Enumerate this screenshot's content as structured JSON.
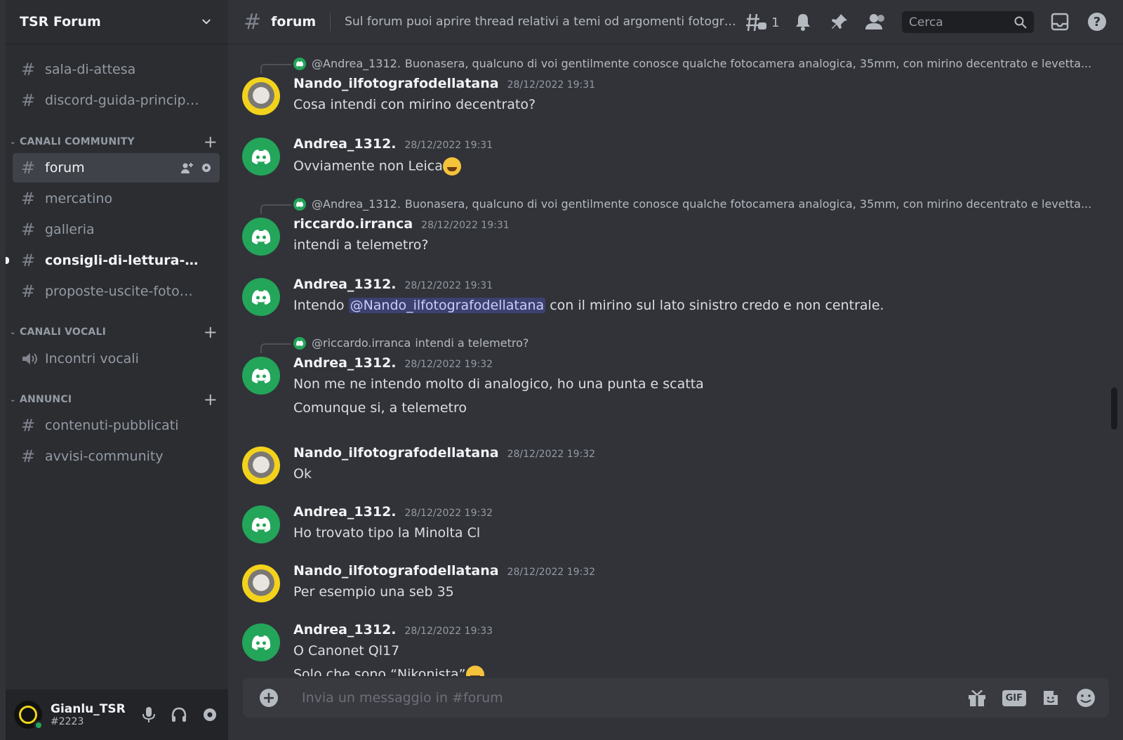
{
  "server": {
    "name": "TSR Forum"
  },
  "channels": {
    "top": [
      {
        "label": "sala-di-attesa"
      },
      {
        "label": "discord-guida-principi..."
      }
    ],
    "categories": [
      {
        "label": "CANALI COMMUNITY",
        "items": [
          {
            "label": "forum",
            "active": true
          },
          {
            "label": "mercatino"
          },
          {
            "label": "galleria"
          },
          {
            "label": "consigli-di-lettura-mo...",
            "unread": true
          },
          {
            "label": "proposte-uscite-fotog..."
          }
        ]
      },
      {
        "label": "CANALI VOCALI",
        "items": [
          {
            "label": "Incontri vocali"
          }
        ]
      },
      {
        "label": "ANNUNCI",
        "items": [
          {
            "label": "contenuti-pubblicati"
          },
          {
            "label": "avvisi-community"
          }
        ]
      }
    ]
  },
  "user": {
    "name": "Gianlu_TSR",
    "tag": "#2223"
  },
  "topbar": {
    "channel": "forum",
    "topic": "Sul forum puoi aprire thread relativi a temi od argomenti fotografici c...",
    "threads_count": "1",
    "search_placeholder": "Cerca"
  },
  "messages": [
    {
      "reply_name": "@Andrea_1312.",
      "reply_text": "Buonasera, qualcuno di voi gentilmente conosce qualche fotocamera analogica, 35mm, con mirino decentrato e levetta...",
      "author": "Nando_ilfotografodellatana",
      "time": "28/12/2022 19:31",
      "lines": [
        "Cosa intendi con mirino decentrato?"
      ]
    },
    {
      "author": "Andrea_1312.",
      "time": "28/12/2022 19:31",
      "lines": [
        "Ovviamente non Leica"
      ]
    },
    {
      "reply_name": "@Andrea_1312.",
      "reply_text": "Buonasera, qualcuno di voi gentilmente conosce qualche fotocamera analogica, 35mm, con mirino decentrato e levetta...",
      "author": "riccardo.irranca",
      "time": "28/12/2022 19:31",
      "lines": [
        "intendi a telemetro?"
      ]
    },
    {
      "author": "Andrea_1312.",
      "time": "28/12/2022 19:31",
      "pre": "Intendo ",
      "mention": "@Nando_ilfotografodellatana",
      "post": " con il mirino sul lato sinistro credo e non centrale."
    },
    {
      "reply_name": "@riccardo.irranca",
      "reply_text": "intendi a telemetro?",
      "author": "Andrea_1312.",
      "time": "28/12/2022 19:32",
      "lines": [
        "Non me ne intendo molto di analogico, ho una punta e scatta",
        "Comunque si, a telemetro"
      ]
    },
    {
      "author": "Nando_ilfotografodellatana",
      "time": "28/12/2022 19:32",
      "lines": [
        "Ok"
      ]
    },
    {
      "author": "Andrea_1312.",
      "time": "28/12/2022 19:32",
      "lines": [
        "Ho trovato tipo la Minolta Cl"
      ]
    },
    {
      "author": "Nando_ilfotografodellatana",
      "time": "28/12/2022 19:32",
      "lines": [
        "Per esempio una seb 35"
      ]
    },
    {
      "author": "Andrea_1312.",
      "time": "28/12/2022 19:33",
      "lines": [
        "O Canonet Ql17",
        "Solo che sono “Nikonista”"
      ]
    }
  ],
  "composer": {
    "placeholder": "Invia un messaggio in #forum"
  },
  "icons": [
    "chevron-down-icon",
    "hash-icon",
    "threads-icon",
    "bell-icon",
    "pin-icon",
    "members-icon",
    "search-icon",
    "inbox-icon",
    "help-icon",
    "plus-icon",
    "gift-icon",
    "gif-icon",
    "sticker-icon",
    "emoji-icon",
    "mic-icon",
    "headphones-icon",
    "settings-icon",
    "speaker-icon",
    "add-member-icon",
    "discord-logo-icon"
  ],
  "colors": {
    "accent": "#5865f2",
    "online": "#23a55a",
    "bg": "#313338",
    "sidebar": "#2b2d31"
  }
}
